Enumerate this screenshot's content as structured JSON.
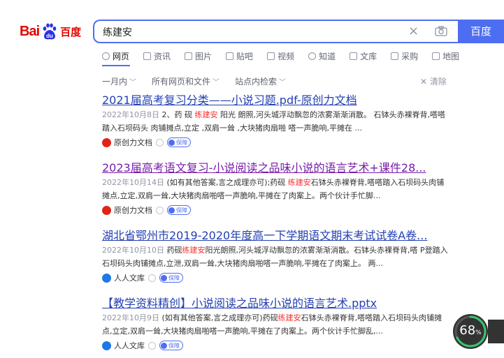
{
  "logo": {
    "part1": "Bai",
    "part2": "du",
    "part3": "百度"
  },
  "search": {
    "query": "练建安",
    "button_label": "百度",
    "clear": "×"
  },
  "tabs": [
    {
      "label": "网页",
      "active": true
    },
    {
      "label": "资讯"
    },
    {
      "label": "图片"
    },
    {
      "label": "贴吧"
    },
    {
      "label": "视频"
    },
    {
      "label": "知道"
    },
    {
      "label": "文库"
    },
    {
      "label": "采购"
    },
    {
      "label": "地图"
    }
  ],
  "filters": {
    "time": "一月内",
    "type": "所有网页和文件",
    "site": "站点内检索",
    "clear": "清除"
  },
  "results": [
    {
      "title": "2021届高考复习分类——小说习题.pdf-原创力文档",
      "date": "2022年10月8日",
      "snippet_before": " 2、药 砚 ",
      "highlight": "练建安",
      "snippet_after": " 阳光 朗照,河头城浮动飘忽的浓雾渐渐消散。 石钵头赤裸脊背,嗒嗒踏入石坝码头 肉铺摊点,立定 ,双肩一耸 ,大块猪肉扇啪 嗒一声脆响,平摊在 ...",
      "source": "原创力文档",
      "badge": "保障",
      "visited": false
    },
    {
      "title": "2023届高考语文复习-小说阅读之品味小说的语言艺术+课件28...",
      "date": "2022年10月14日",
      "snippet_before": " (如有其他答案,言之成理亦可);药砚 ",
      "highlight": "练建安",
      "snippet_after": "石钵头赤裸脊背,嗒嗒踏入石坝码头肉铺摊点,立定,双肩一耸,大块猪肉扇啪嗒一声脆响,平摊在了肉案上。两个伙计手忙脚...",
      "source": "原创力文档",
      "badge": "保障",
      "visited": true
    },
    {
      "title": "湖北省鄂州市2019-2020年度高一下学期语文期末考试试卷A卷...",
      "date": "2022年10月10日",
      "snippet_before": " 药砚",
      "highlight": "练建安",
      "snippet_after": "阳光朗照,河头城浮动飘忽的浓雾渐渐消散。石钵头赤裸脊背,嗒 P登踏入石坝码头肉铺摊点,立泄,双肩一耸,大块猪肉扇啪嗒一声脆响,平摊在了肉案上。 两...",
      "source": "人人文库",
      "badge": "保障",
      "visited": false
    },
    {
      "title": "【教学资料精创】小说阅读之品味小说的语言艺术.pptx",
      "date": "2022年10月9日",
      "snippet_before": " (如有其他答案,言之成理亦可)药砚",
      "highlight": "练建安",
      "snippet_after": "石钵头赤裸脊背,嗒嗒踏入石坝码头肉铺摊点,立定,双肩一耸,大块猪肉扇啪嗒一声脆响,平摊在了肉案上。两个伙计手忙脚乱,...",
      "source": "人人文库",
      "badge": "保障",
      "visited": false
    }
  ],
  "progress": {
    "value": "68",
    "unit": "%",
    "fraction": 0.68
  },
  "colors": {
    "accent": "#4e6ef2",
    "brand_red": "#e10602",
    "highlight": "#f73131",
    "link": "#2440b3",
    "visited": "#771caa"
  }
}
